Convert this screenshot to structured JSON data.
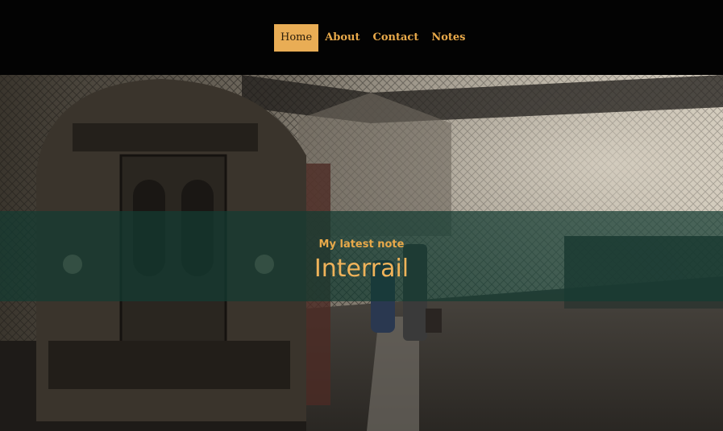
{
  "nav": {
    "items": [
      {
        "label": "Home",
        "active": true
      },
      {
        "label": "About",
        "active": false
      },
      {
        "label": "Contact",
        "active": false
      },
      {
        "label": "Notes",
        "active": false
      }
    ]
  },
  "hero": {
    "image": "train-station-platform-photo",
    "subtitle": "My latest note",
    "title": "Interrail"
  },
  "colors": {
    "accent": "#e9ad55",
    "topbar": "#030303",
    "banner_overlay": "#143c32"
  }
}
